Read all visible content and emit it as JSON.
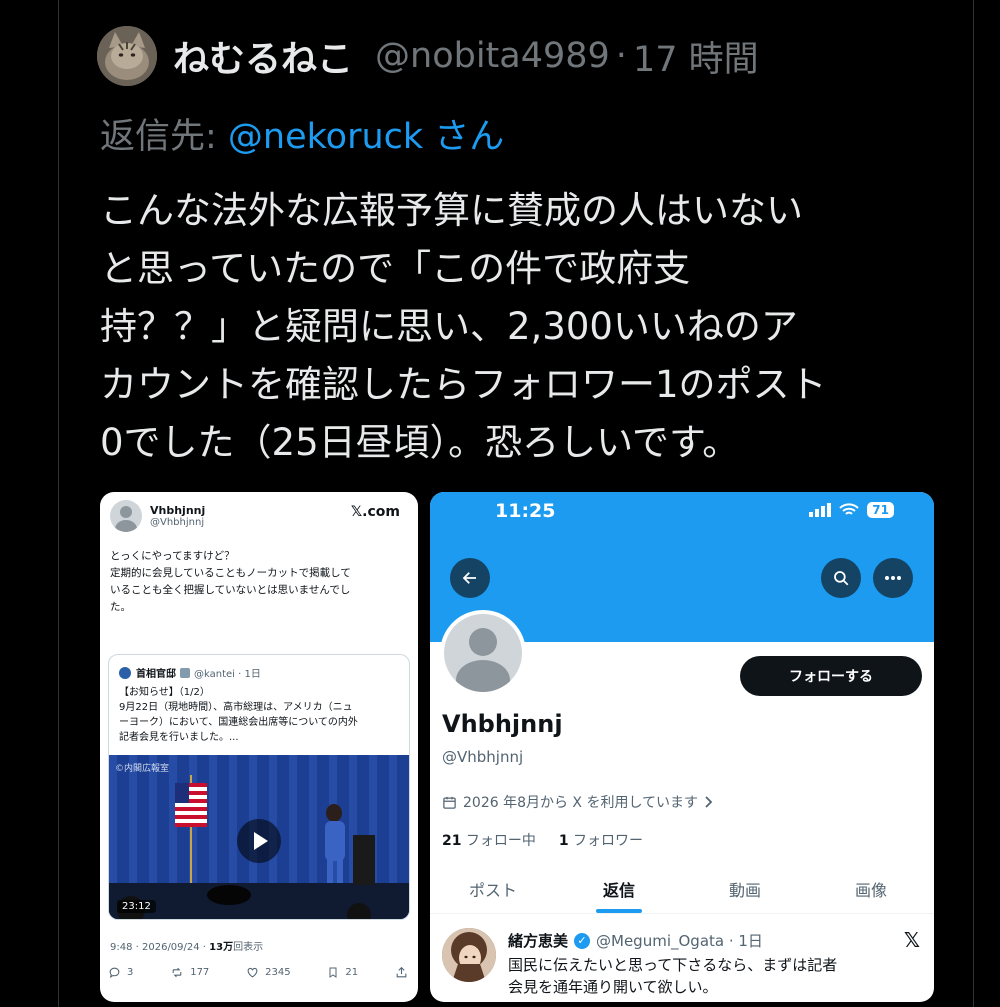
{
  "tweet": {
    "author_name": "ねむるねこ",
    "author_handle": "@nobita4989",
    "separator": "·",
    "time": "17 時間",
    "reply_prefix": "返信先: ",
    "reply_mention": "@nekoruck",
    "reply_suffix": " さん",
    "text_lines": [
      "こんな法外な広報予算に賛成の人はいない",
      "と思っていたので「この件で政府支",
      "持？？」と疑問に思い、2,300いいねのア",
      "カウントを確認したらフォロワー1のポスト",
      "0でした（25日昼頃）。恐ろしいです。"
    ]
  },
  "left_screenshot": {
    "name": "Vhbhjnnj",
    "handle": "@Vhbhjnnj",
    "site": "𝕏.com",
    "text_lines": [
      "とっくにやってますけど？",
      "定期的に会見していることもノーカットで掲載して",
      "いることも全く把握していないとは思いませんでし",
      "た。"
    ],
    "quote": {
      "name": "首相官邸",
      "handle": "@kantei · 1日",
      "lines": [
        "【お知らせ】（1/2）",
        "9月22日（現地時間）、高市総理は、アメリカ（ニュ",
        "ーヨーク）において、国連総会出席等についての内外",
        "記者会見を行いました。..."
      ],
      "watermark": "©内閣広報室",
      "duration": "23:12"
    },
    "meta_prefix": "9:48 · 2026/09/24 · ",
    "meta_views": "13万",
    "meta_suffix": "回表示",
    "actions": {
      "replies": "3",
      "reposts": "177",
      "likes": "2345",
      "bookmarks": "21"
    }
  },
  "right_screenshot": {
    "status_time": "11:25",
    "battery": "71",
    "follow_label": "フォローする",
    "name": "Vhbhjnnj",
    "handle": "@Vhbhjnnj",
    "joined": "2026 年8月から X を利用しています",
    "following_count": "21",
    "following_label": " フォロー中",
    "followers_count": "1",
    "followers_label": " フォロワー",
    "tabs": [
      "ポスト",
      "返信",
      "動画",
      "画像"
    ],
    "active_tab": "返信",
    "reply": {
      "name": "緒方恵美",
      "handle": "@Megumi_Ogata · 1日",
      "lines": [
        "国民に伝えたいと思って下さるなら、まずは記者",
        "会見を通年通り開いて欲しい。"
      ]
    }
  },
  "colors": {
    "background": "#000000",
    "muted": "#71767b",
    "accent": "#1d9bf0",
    "text": "#e7e9ea"
  }
}
